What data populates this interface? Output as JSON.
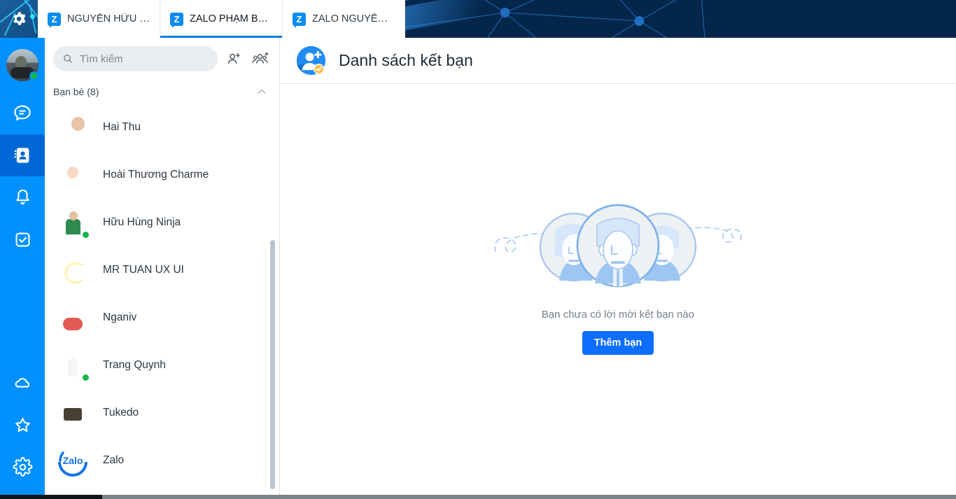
{
  "window": {
    "gear_icon": "gear-icon",
    "bottom_bar": "taskbar-strip"
  },
  "tabs": [
    {
      "label": "NGUYỄN HỮU H...",
      "badge": "Z",
      "active": false
    },
    {
      "label": "ZALO PHẠM BÁ ...",
      "badge": "Z",
      "active": true
    },
    {
      "label": "ZALO NGUYỄN B...",
      "badge": "Z",
      "active": false
    }
  ],
  "rail": {
    "avatar_alt": "user-avatar",
    "status": "online",
    "items": [
      {
        "name": "messages",
        "icon": "chat-bubble-icon",
        "active": false
      },
      {
        "name": "contacts",
        "icon": "contacts-book-icon",
        "active": true
      },
      {
        "name": "notifications",
        "icon": "bell-icon",
        "active": false
      },
      {
        "name": "todo",
        "icon": "checkbox-icon",
        "active": false
      }
    ],
    "bottom_items": [
      {
        "name": "cloud",
        "icon": "cloud-icon"
      },
      {
        "name": "favorites",
        "icon": "star-icon"
      },
      {
        "name": "settings",
        "icon": "gear-icon"
      }
    ]
  },
  "search": {
    "placeholder": "Tìm kiếm",
    "value": "",
    "add_friend_icon": "add-friend-icon",
    "add_group_icon": "add-group-icon"
  },
  "friend_group": {
    "title": "Bạn bè (8)",
    "count": 8,
    "collapsed": false,
    "chevron": "chevron-up-icon"
  },
  "friends": [
    {
      "name": "Hai Thu",
      "avatar": "a-haithu",
      "online": false
    },
    {
      "name": "Hoài Thương Charme",
      "avatar": "a-hoai",
      "online": false
    },
    {
      "name": "Hữu Hùng Ninja",
      "avatar": "a-hung",
      "online": true
    },
    {
      "name": "MR TUAN UX UI",
      "avatar": "a-tuan",
      "online": false
    },
    {
      "name": "Nganiv",
      "avatar": "a-nganiv",
      "online": false
    },
    {
      "name": "Trang Quynh",
      "avatar": "a-trang",
      "online": true
    },
    {
      "name": "Tukedo",
      "avatar": "a-tukedo",
      "online": false
    },
    {
      "name": "Zalo",
      "avatar": "a-zalo",
      "online": false
    }
  ],
  "main": {
    "title": "Danh sách kết bạn",
    "header_icon": "add-friend-avatar-icon",
    "header_badge_icon": "verified-check-icon",
    "empty": {
      "illustration": "three-people-illustration",
      "text": "Bạn chưa có lời mời kết bạn nào",
      "button_label": "Thêm bạn"
    }
  },
  "colors": {
    "rail_blue": "#0091ff",
    "rail_active_blue": "#0068d6",
    "accent_blue": "#0d6efd",
    "tab_underline": "#0f7fe0",
    "online_green": "#15b74b",
    "deco_navy": "#04264b",
    "illustration_blue": "#a8c8f0"
  }
}
